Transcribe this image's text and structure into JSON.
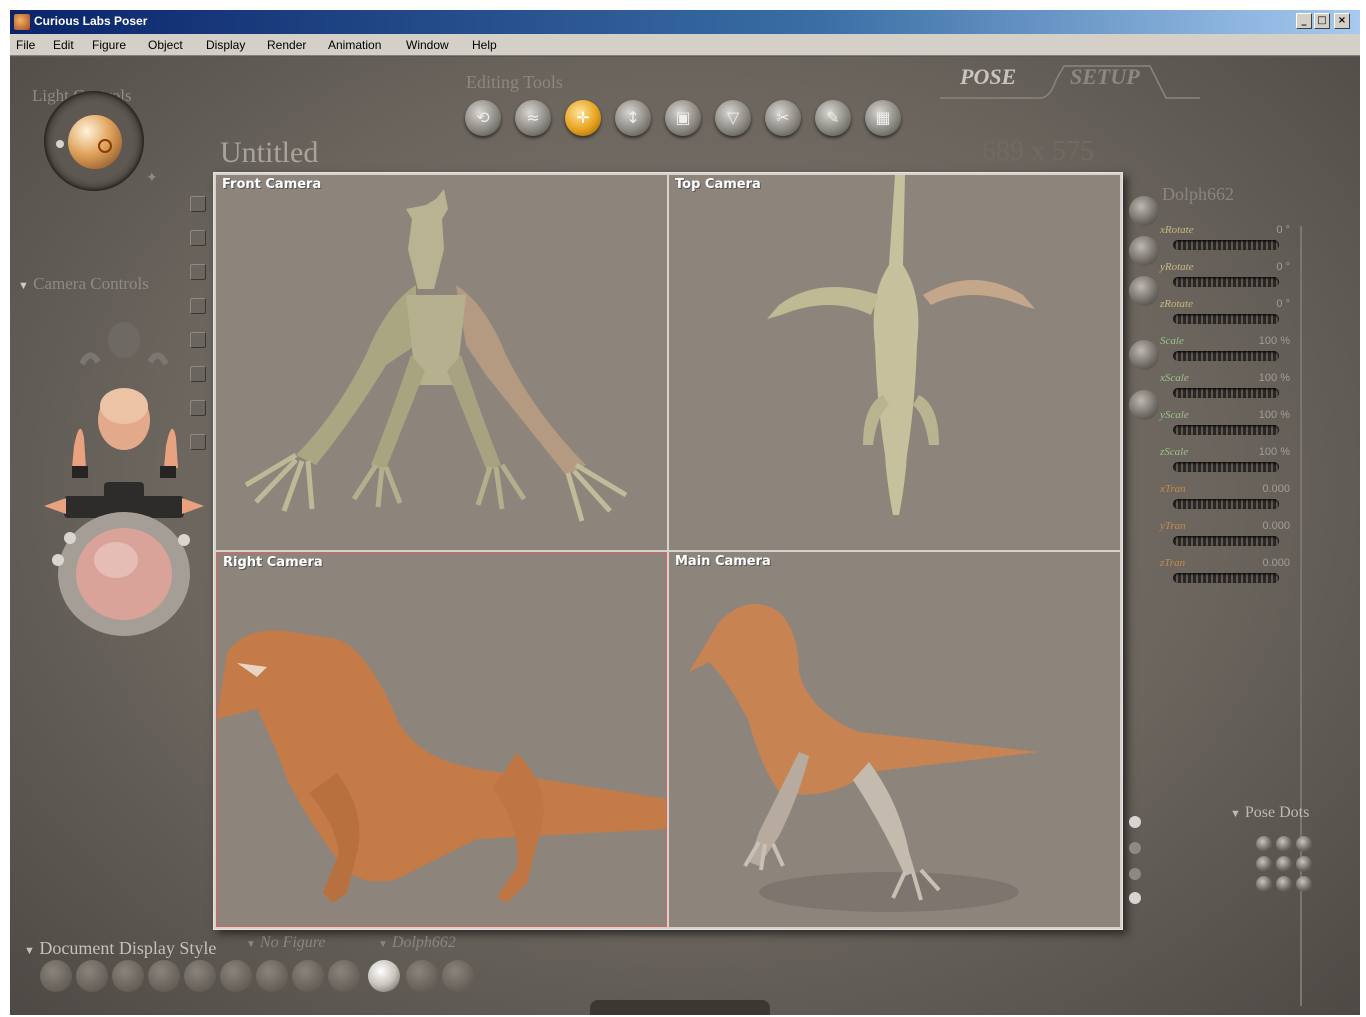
{
  "window": {
    "title": "Curious Labs Poser",
    "controls": [
      "_",
      "□",
      "×"
    ]
  },
  "menu": [
    "File",
    "Edit",
    "Figure",
    "Object",
    "Display",
    "Render",
    "Animation",
    "Window",
    "Help"
  ],
  "panels": {
    "light_controls": "Light Controls",
    "camera_controls": "Camera Controls",
    "editing_tools": "Editing Tools",
    "document_display_style": "Document Display Style",
    "pose_dots": "Pose Dots"
  },
  "tabs": {
    "pose": "POSE",
    "setup": "SETUP"
  },
  "document": {
    "title": "Untitled",
    "size": "689 x 575"
  },
  "selection": {
    "figure": "No Figure",
    "actor": "Dolph662"
  },
  "cameras": [
    "Front Camera",
    "Top Camera",
    "Right Camera",
    "Main Camera"
  ],
  "parameters": {
    "title": "Dolph662",
    "items": [
      {
        "name": "xRotate",
        "value": "0 °"
      },
      {
        "name": "yRotate",
        "value": "0 °"
      },
      {
        "name": "zRotate",
        "value": "0 °"
      },
      {
        "name": "Scale",
        "value": "100 %"
      },
      {
        "name": "xScale",
        "value": "100 %"
      },
      {
        "name": "yScale",
        "value": "100 %"
      },
      {
        "name": "zScale",
        "value": "100 %"
      },
      {
        "name": "xTran",
        "value": "0.000"
      },
      {
        "name": "yTran",
        "value": "0.000"
      },
      {
        "name": "zTran",
        "value": "0.000"
      }
    ]
  },
  "tools": [
    {
      "name": "rotate",
      "glyph": "⟲"
    },
    {
      "name": "twist",
      "glyph": "≈"
    },
    {
      "name": "translate",
      "glyph": "✛"
    },
    {
      "name": "translate-in-out",
      "glyph": "↕"
    },
    {
      "name": "scale",
      "glyph": "▣"
    },
    {
      "name": "taper",
      "glyph": "▽"
    },
    {
      "name": "chain-break",
      "glyph": "✂"
    },
    {
      "name": "color",
      "glyph": "✎"
    },
    {
      "name": "grouping",
      "glyph": "▦"
    }
  ],
  "colors": {
    "workspace": "#6b655e",
    "accent": "#e6a21c",
    "title_bar": "#0a246a"
  }
}
